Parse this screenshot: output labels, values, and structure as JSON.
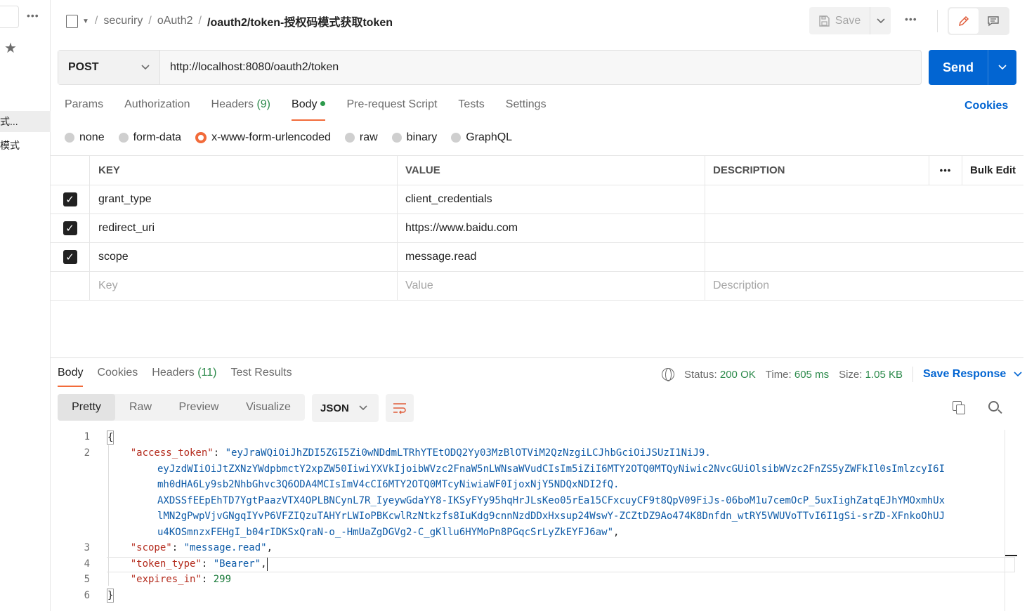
{
  "sidebar": {
    "dots": "•••",
    "star": "★",
    "items": [
      {
        "label": "式..."
      },
      {
        "label": "模式"
      }
    ]
  },
  "header": {
    "breadcrumb": [
      "securiry",
      "oAuth2"
    ],
    "separator": "/",
    "title": "/oauth2/token-授权码模式获取token",
    "save_label": "Save",
    "more": "•••"
  },
  "request": {
    "method": "POST",
    "url": "http://localhost:8080/oauth2/token",
    "send_label": "Send"
  },
  "request_tabs": {
    "params": "Params",
    "authorization": "Authorization",
    "headers": "Headers",
    "headers_count": "(9)",
    "body": "Body",
    "pre_request": "Pre-request Script",
    "tests": "Tests",
    "settings": "Settings",
    "cookies": "Cookies"
  },
  "body_types": {
    "none": "none",
    "form_data": "form-data",
    "urlencoded": "x-www-form-urlencoded",
    "raw": "raw",
    "binary": "binary",
    "graphql": "GraphQL",
    "selected": "x-www-form-urlencoded"
  },
  "params_table": {
    "headers": {
      "key": "KEY",
      "value": "VALUE",
      "description": "DESCRIPTION",
      "more": "•••",
      "bulk_edit": "Bulk Edit"
    },
    "rows": [
      {
        "checked": true,
        "key": "grant_type",
        "value": "client_credentials",
        "description": ""
      },
      {
        "checked": true,
        "key": "redirect_uri",
        "value": "https://www.baidu.com",
        "description": ""
      },
      {
        "checked": true,
        "key": "scope",
        "value": "message.read",
        "description": ""
      }
    ],
    "placeholders": {
      "key": "Key",
      "value": "Value",
      "description": "Description"
    }
  },
  "response_tabs": {
    "body": "Body",
    "cookies": "Cookies",
    "headers": "Headers",
    "headers_count": "(11)",
    "test_results": "Test Results"
  },
  "status": {
    "status_label": "Status:",
    "status_value": "200 OK",
    "time_label": "Time:",
    "time_value": "605 ms",
    "size_label": "Size:",
    "size_value": "1.05 KB",
    "save_response": "Save Response"
  },
  "view_modes": {
    "pretty": "Pretty",
    "raw": "Raw",
    "preview": "Preview",
    "visualize": "Visualize",
    "selected": "Pretty"
  },
  "format": "JSON",
  "code": {
    "line_numbers": [
      "1",
      "2",
      "3",
      "4",
      "5",
      "6"
    ],
    "open_brace": "{",
    "close_brace": "}",
    "access_token_key": "\"access_token\"",
    "access_token_lines": [
      "\"eyJraWQiOiJhZDI5ZGI5Zi0wNDdmLTRhYTEtODQ2Yy03MzBlOTViM2QzNzgiLCJhbGciOiJSUzI1NiJ9.",
      "eyJzdWIiOiJtZXNzYWdpbmctY2xpZW50IiwiYXVkIjoibWVzc2FnaW5nLWNsaWVudCIsIm5iZiI6MTY2OTQ0MTQyNiwic2NvcGUiOlsibWVzc2FnZS5yZWFkIl0sImlzcyI6I",
      "mh0dHA6Ly9sb2NhbGhvc3Q6ODA4MCIsImV4cCI6MTY2OTQ0MTcyNiwiaWF0IjoxNjY5NDQxNDI2fQ.",
      "AXDSSfEEpEhTD7YgtPaazVTX4OPLBNCynL7R_IyeywGdaYY8-IKSyFYy95hqHrJLsKeo05rEa15CFxcuyCF9t8QpV09FiJs-06boM1u7cemOcP_5uxIighZatqEJhYMOxmhUx",
      "lMN2gPwpVjvGNgqIYvP6VFZIQzuTAHYrLWIoPBKcwlRzNtkzfs8IuKdg9cnnNzdDDxHxsup24WswY-ZCZtDZ9Ao474K8Dnfdn_wtRY5VWUVoTTvI6I1gSi-srZD-XFnkoOhUJ",
      "u4KOSmnzxFEHgI_b04rIDKSxQraN-o_-HmUaZgDGVg2-C_gKllu6HYMoPn8PGqcSrLyZkEYFJ6aw\""
    ],
    "scope_key": "\"scope\"",
    "scope_value": "\"message.read\"",
    "token_type_key": "\"token_type\"",
    "token_type_value": "\"Bearer\"",
    "expires_in_key": "\"expires_in\"",
    "expires_in_value": "299"
  }
}
